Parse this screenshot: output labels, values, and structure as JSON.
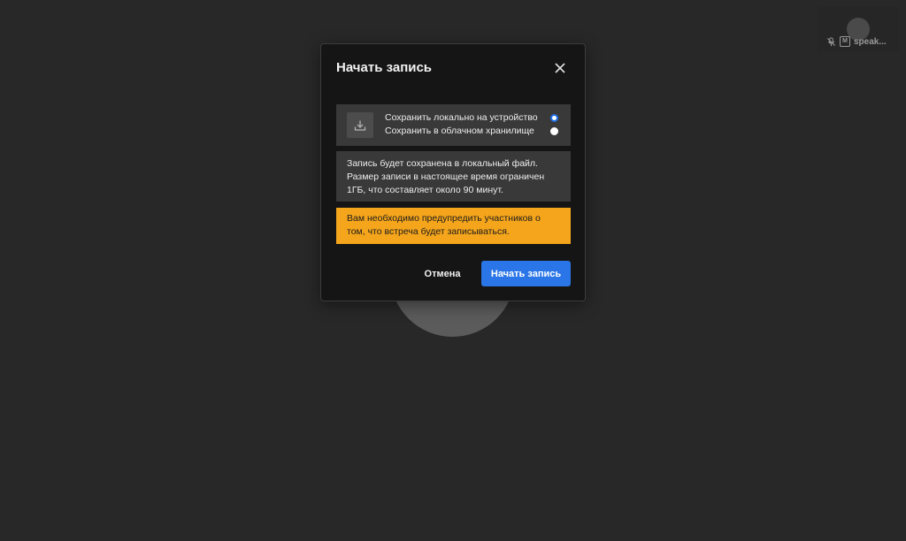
{
  "participant": {
    "name": "speak...",
    "mic_icon": "mic-muted-icon",
    "badge_letter": "M"
  },
  "dialog": {
    "title": "Начать запись",
    "close_icon": "close-icon",
    "save_options": {
      "icon": "download-icon",
      "items": [
        {
          "label": "Сохранить локально на устройство",
          "selected": true
        },
        {
          "label": "Сохранить в облачном хранилище",
          "selected": false
        }
      ]
    },
    "info_lines": [
      "Запись будет сохранена в локальный файл.",
      "Размер записи в настоящее время ограничен",
      "1ГБ, что составляет около 90 минут."
    ],
    "warning_lines": [
      "Вам необходимо предупредить участников о",
      "том, что встреча будет записываться."
    ],
    "cancel_label": "Отмена",
    "start_label": "Начать запись"
  },
  "colors": {
    "background": "#282828",
    "dialog_bg": "#151515",
    "panel_bg": "#393939",
    "warning_bg": "#f5a51b",
    "accent": "#2a76e8"
  }
}
